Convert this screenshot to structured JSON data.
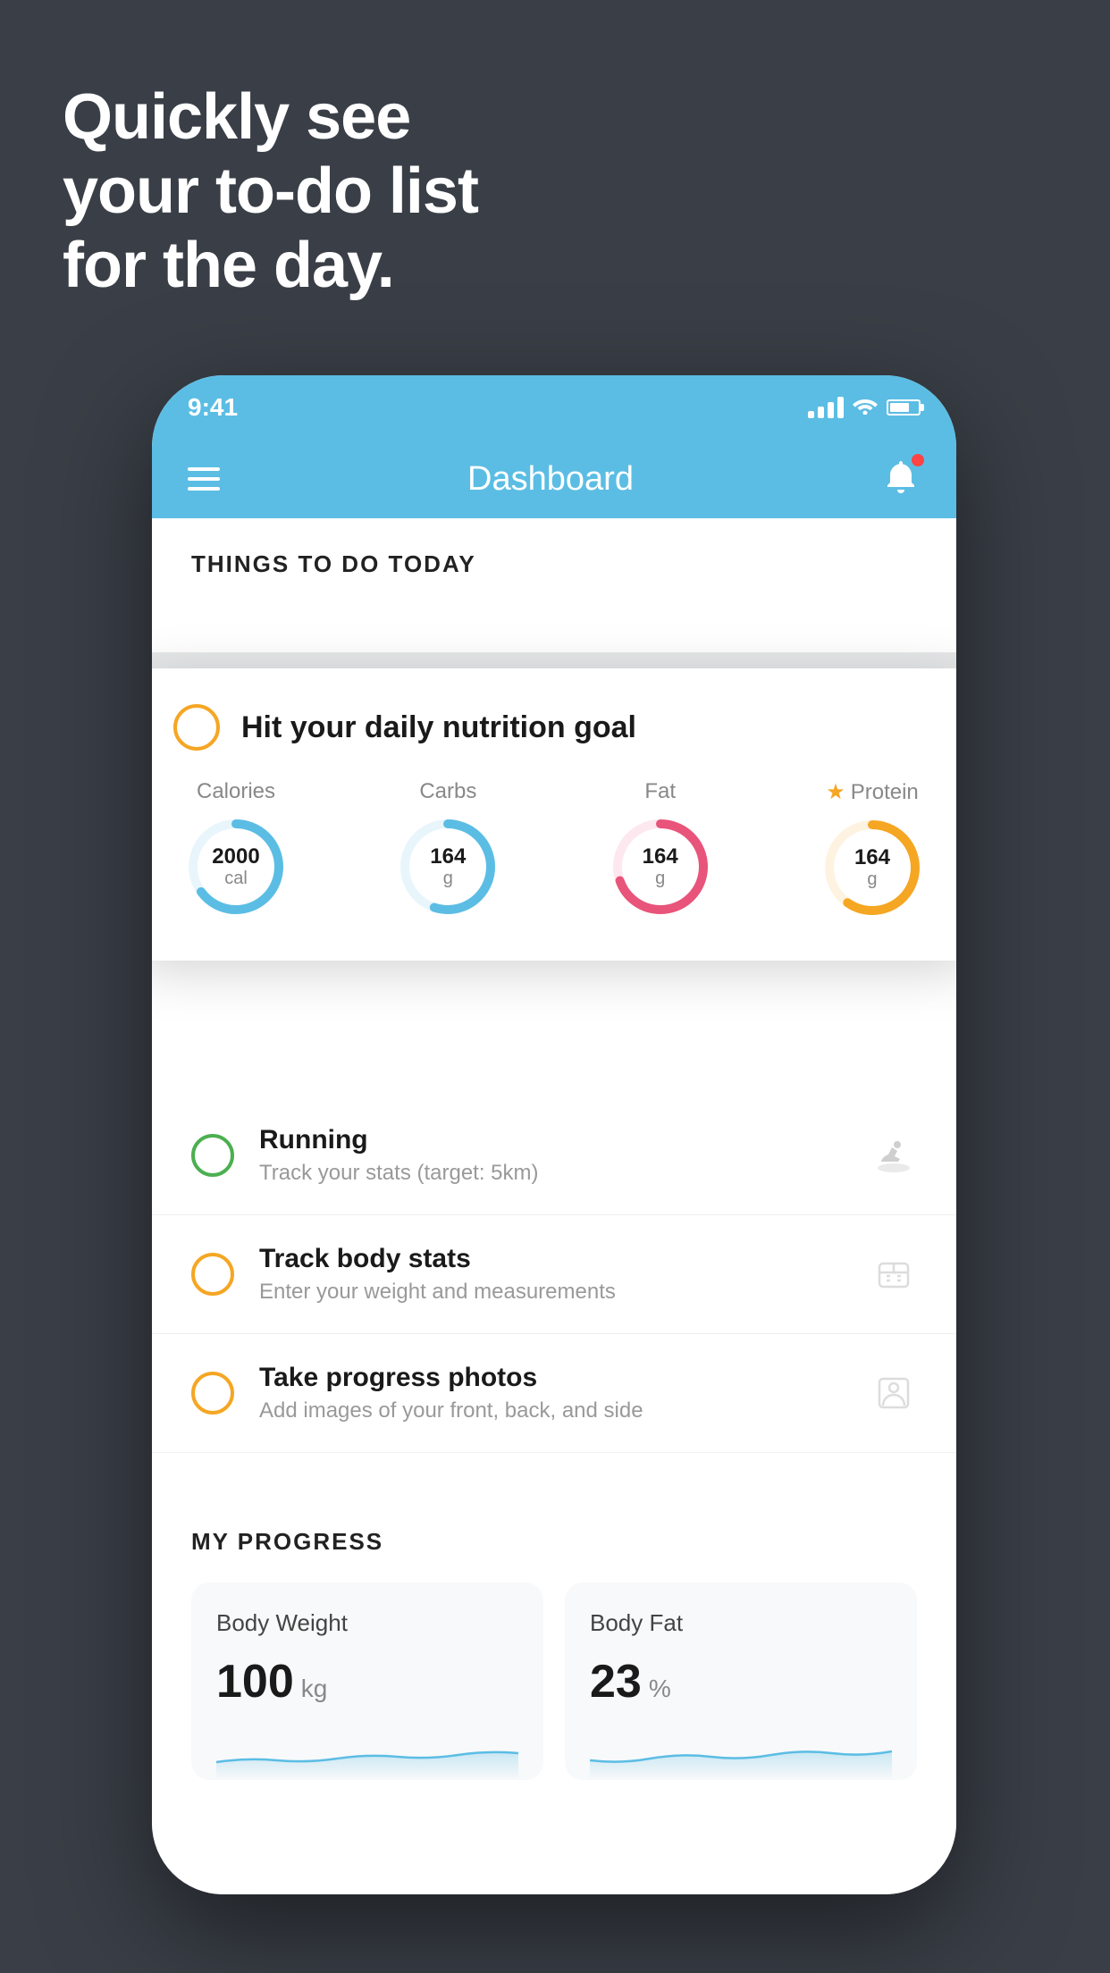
{
  "hero": {
    "line1": "Quickly see",
    "line2": "your to-do list",
    "line3": "for the day."
  },
  "status_bar": {
    "time": "9:41"
  },
  "nav": {
    "title": "Dashboard"
  },
  "things_section": {
    "header": "THINGS TO DO TODAY"
  },
  "floating_card": {
    "title": "Hit your daily nutrition goal",
    "nutrition": [
      {
        "label": "Calories",
        "value": "2000",
        "unit": "cal",
        "color": "#5bbde4",
        "bg": "#e8f6fc",
        "percent": 65
      },
      {
        "label": "Carbs",
        "value": "164",
        "unit": "g",
        "color": "#5bbde4",
        "bg": "#e8f6fc",
        "percent": 55
      },
      {
        "label": "Fat",
        "value": "164",
        "unit": "g",
        "color": "#e8547a",
        "bg": "#fde8ef",
        "percent": 70
      },
      {
        "label": "Protein",
        "value": "164",
        "unit": "g",
        "color": "#f5a623",
        "bg": "#fef3e0",
        "percent": 60,
        "starred": true
      }
    ]
  },
  "todo_items": [
    {
      "id": "running",
      "title": "Running",
      "subtitle": "Track your stats (target: 5km)",
      "circle_color": "green",
      "icon": "shoe"
    },
    {
      "id": "body-stats",
      "title": "Track body stats",
      "subtitle": "Enter your weight and measurements",
      "circle_color": "yellow",
      "icon": "scale"
    },
    {
      "id": "photos",
      "title": "Take progress photos",
      "subtitle": "Add images of your front, back, and side",
      "circle_color": "yellow",
      "icon": "person"
    }
  ],
  "progress_section": {
    "header": "MY PROGRESS",
    "cards": [
      {
        "title": "Body Weight",
        "value": "100",
        "unit": "kg"
      },
      {
        "title": "Body Fat",
        "value": "23",
        "unit": "%"
      }
    ]
  }
}
